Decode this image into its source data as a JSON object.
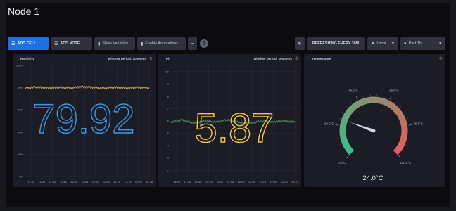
{
  "dashboard": {
    "title": "Node 1"
  },
  "toolbar": {
    "add_cell": "ADD CELL",
    "add_note": "ADD NOTE",
    "show_variables": "Show Variables",
    "enable_annotations": "Enable Annotations",
    "more": "—",
    "help": "?",
    "refresh": "REFRESHING EVERY 30M",
    "timezone": "Local",
    "time_range": "Past 1h"
  },
  "colors": {
    "accent": "#1f6fe0",
    "humidity": "#3a9ae0",
    "humidity_line": "#d3a848",
    "ph": "#f4c441",
    "ph_line": "#4f8a5a",
    "gauge_low": "#3bbf8c",
    "gauge_high": "#ea5a5a"
  },
  "cells": {
    "humidity": {
      "name": "Humidity",
      "period": "window period: 10000ms",
      "value": "79.92",
      "y_ticks": [
        "100%",
        "80%",
        "60%",
        "40%",
        "20%",
        "0%"
      ],
      "x_ticks": [
        "11:30",
        "11:35",
        "11:40",
        "11:45",
        "11:50",
        "11:55",
        "12:00",
        "12:05",
        "12:10",
        "12:15",
        "12:20",
        "12:25"
      ]
    },
    "ph": {
      "name": "Ph",
      "period": "window period: 10000ms",
      "value": "5.87",
      "y_ticks": [
        "10",
        "9",
        "8",
        "7",
        "6",
        "5",
        "4",
        "3",
        "2"
      ],
      "x_ticks": [
        "11:30",
        "11:35",
        "11:40",
        "11:45",
        "11:50",
        "11:55",
        "12:00",
        "12:05",
        "12:10",
        "12:15",
        "12:20",
        "12:25"
      ]
    },
    "temperature": {
      "name": "Temperature",
      "value": "24.0°C",
      "ticks": [
        "0.0°C",
        "20.0°C",
        "40.0°C",
        "60.0°C",
        "80.0°C",
        "100.0°C"
      ]
    }
  },
  "chart_data": [
    {
      "type": "line",
      "title": "Humidity",
      "ylim": [
        0,
        100
      ],
      "y_tick_values": [
        100,
        80,
        60,
        40,
        20,
        0
      ],
      "x": [
        "11:30",
        "11:35",
        "11:40",
        "11:45",
        "11:50",
        "11:55",
        "12:00",
        "12:05",
        "12:10",
        "12:15",
        "12:20",
        "12:25"
      ],
      "series": [
        {
          "values": [
            79.6,
            80.6,
            79.9,
            80.3,
            79.7,
            80.8,
            80.1,
            79.5,
            80.4,
            79.8,
            80.2,
            79.9
          ]
        }
      ],
      "grid": true
    },
    {
      "type": "line",
      "title": "Ph",
      "ylim": [
        1.5,
        10.5
      ],
      "y_tick_values": [
        10,
        9,
        8,
        7,
        6,
        5,
        4,
        3,
        2
      ],
      "x": [
        "11:30",
        "11:35",
        "11:40",
        "11:45",
        "11:50",
        "11:55",
        "12:00",
        "12:05",
        "12:10",
        "12:15",
        "12:20",
        "12:25"
      ],
      "series": [
        {
          "values": [
            5.9,
            6.1,
            5.8,
            6.0,
            5.9,
            6.1,
            5.9,
            5.8,
            6.0,
            5.9,
            6.0,
            5.9
          ]
        }
      ],
      "grid": true
    },
    {
      "type": "gauge",
      "title": "Temperature",
      "ylim": [
        0,
        100
      ],
      "value": 24.0,
      "unit": "°C",
      "tick_values": [
        0,
        20,
        40,
        60,
        80,
        100
      ]
    }
  ]
}
